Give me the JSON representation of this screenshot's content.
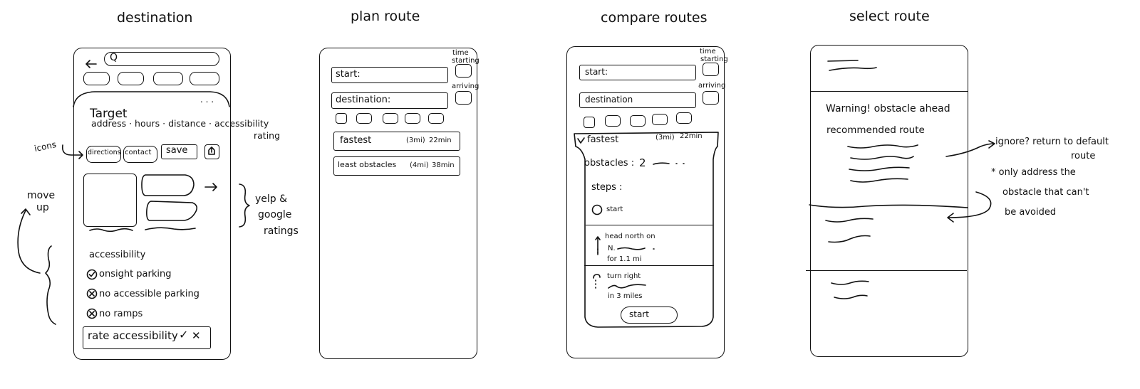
{
  "screens": [
    {
      "title": "destination",
      "search_icon": "Q",
      "back_icon": "back-arrow-icon",
      "more_dots": ". . .",
      "place_name": "Target",
      "info_line": "address · hours · distance · accessibility",
      "info_rating": "rating",
      "buttons": [
        "directions",
        "contact",
        "save",
        "share-icon"
      ],
      "accessibility_header": "accessibility",
      "accessibility_items": [
        {
          "mark": "check",
          "text": "onsight parking"
        },
        {
          "mark": "x",
          "text": "no accessible parking"
        },
        {
          "mark": "x",
          "text": "no ramps"
        }
      ],
      "rate_label": "rate accessibility",
      "rate_yes": "✓",
      "rate_no": "✕"
    },
    {
      "title": "plan route",
      "start_label": "start:",
      "destination_label": "destination:",
      "time_label_1": "time",
      "time_label_2": "starting",
      "arriving_label": "arriving",
      "routes": [
        {
          "name": "fastest",
          "dist": "(3mi)",
          "time": "22min"
        },
        {
          "name": "least obstacles",
          "dist": "(4mi)",
          "time": "38min"
        }
      ]
    },
    {
      "title": "compare routes",
      "start_label": "start:",
      "destination_label": "destination",
      "time_label_1": "time",
      "time_label_2": "starting",
      "arriving_label": "arriving",
      "route": {
        "name": "fastest",
        "dist": "(3mi)",
        "time": "22min"
      },
      "obstacles_label": "obstacles :",
      "obstacles_value": "2",
      "steps_label": "steps :",
      "start_step": "start",
      "step1_title": "head north on",
      "step1_sub1": "N.",
      "step1_sub2": "for 1.1 mi",
      "step2_title": "turn right",
      "step2_sub": "in 3 miles",
      "start_button": "start"
    },
    {
      "title": "select route",
      "warning": "Warning! obstacle ahead",
      "recommended": "recommended route"
    }
  ],
  "annotations": {
    "icons": "icons",
    "move_up_1": "move",
    "move_up_2": "up",
    "yelp_1": "yelp &",
    "yelp_2": "google",
    "yelp_3": "ratings",
    "ignore_1": "ignore? return to default",
    "ignore_2": "route",
    "note_1": "* only address the",
    "note_2": "obstacle that can't",
    "note_3": "be avoided"
  }
}
